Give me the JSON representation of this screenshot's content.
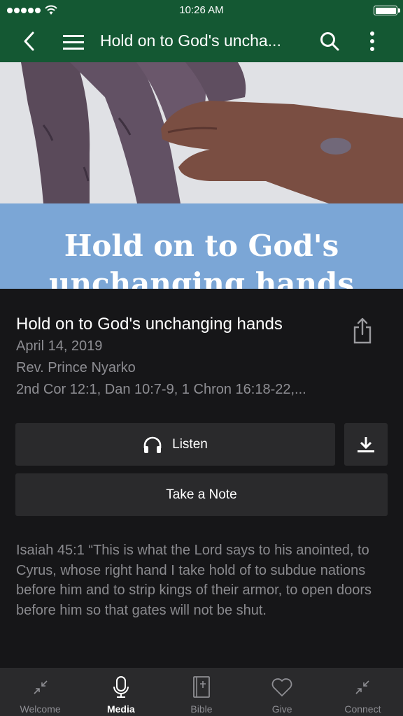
{
  "status_bar": {
    "time": "10:26 AM"
  },
  "nav": {
    "title": "Hold on to God's uncha..."
  },
  "hero": {
    "banner_text": "Hold on to God's unchanging hands"
  },
  "sermon": {
    "title": "Hold on to God's unchanging hands",
    "date": "April 14, 2019",
    "speaker": "Rev. Prince Nyarko",
    "references": "2nd Cor 12:1, Dan 10:7-9, 1 Chron 16:18-22,..."
  },
  "actions": {
    "listen_label": "Listen",
    "note_label": "Take a Note"
  },
  "scripture": "Isaiah 45:1 “This is what the Lord says to his anointed, to Cyrus, whose right hand I take hold of to subdue nations before him and to strip kings of their armor, to open doors before him so that gates will not be shut.",
  "tabs": [
    {
      "label": "Welcome",
      "icon": "collapse-arrows-icon"
    },
    {
      "label": "Media",
      "icon": "microphone-icon",
      "active": true
    },
    {
      "label": "Bible",
      "icon": "bible-icon"
    },
    {
      "label": "Give",
      "icon": "heart-icon"
    },
    {
      "label": "Connect",
      "icon": "collapse-arrows-icon"
    }
  ],
  "colors": {
    "header": "#145833",
    "banner": "#7ba6d6",
    "background": "#161618",
    "button": "#2a2a2c"
  }
}
